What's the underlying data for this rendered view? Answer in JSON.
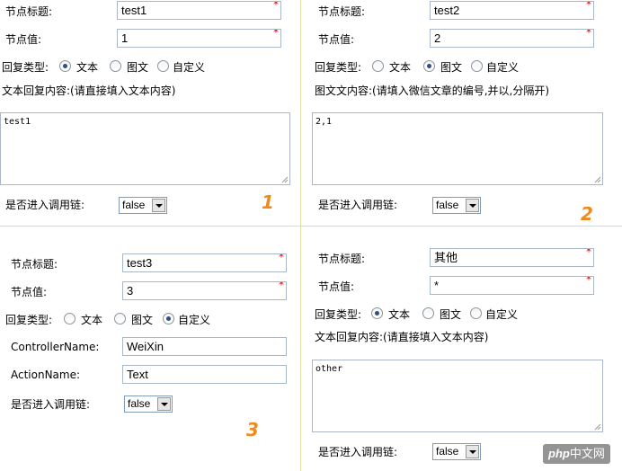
{
  "labels": {
    "node_title": "节点标题:",
    "node_value": "节点值:",
    "reply_type": "回复类型:",
    "opt_text": "文本",
    "opt_news": "图文",
    "opt_custom": "自定义",
    "text_reply_content": "文本回复内容:(请直接填入文本内容)",
    "news_content": "图文文内容:(请填入微信文章的编号,并以,分隔开)",
    "chain": "是否进入调用链:",
    "controller": "ControllerName:",
    "action": "ActionName:"
  },
  "required_mark": "*",
  "panels": {
    "p1": {
      "title": "test1",
      "value": "1",
      "reply": "text",
      "content": "test1",
      "chain": "false",
      "badge": "1"
    },
    "p2": {
      "title": "test2",
      "value": "2",
      "reply": "news",
      "content": "2,1",
      "chain": "false",
      "badge": "2"
    },
    "p3": {
      "title": "test3",
      "value": "3",
      "reply": "custom",
      "controller": "WeiXin",
      "action": "Text",
      "chain": "false",
      "badge": "3"
    },
    "p4": {
      "title": "其他",
      "value": "*",
      "reply": "text",
      "content": "other",
      "chain": "false"
    }
  },
  "watermark": {
    "brand": "php",
    "site": "中文网"
  },
  "colors": {
    "badge": "#f08a1c",
    "divider": "#d8e2a8",
    "required": "#dd0000"
  }
}
